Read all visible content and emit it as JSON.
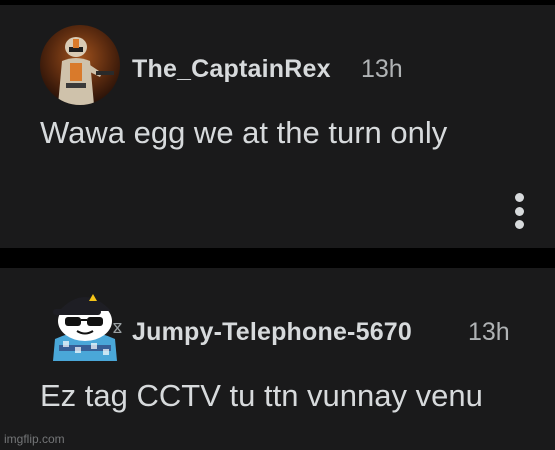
{
  "comments": [
    {
      "username": "The_CaptainRex",
      "time": "13h",
      "body": "Wawa egg we at the turn only",
      "avatar_icon": "clone-trooper-avatar-icon",
      "menu_icon": "more-vertical-icon"
    },
    {
      "username": "Jumpy-Telephone-5670",
      "time": "13h",
      "body": "Ez tag CCTV tu ttn vunnay venu",
      "avatar_icon": "snoo-sunglasses-cap-avatar-icon"
    }
  ],
  "watermark": "imgflip.com",
  "colors": {
    "background": "#000000",
    "card": "#1a1a1b",
    "text": "#d7dadc",
    "muted": "#b0b3b5"
  }
}
